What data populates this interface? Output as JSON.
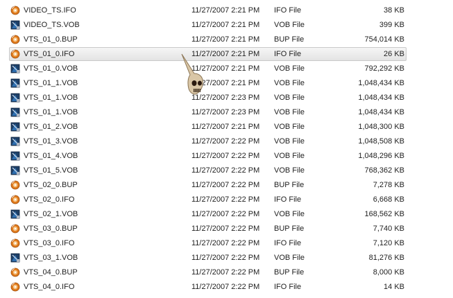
{
  "icons": {
    "IFO File": "ifo-file-icon",
    "BUP File": "bup-file-icon",
    "VOB File": "vob-file-icon"
  },
  "selected_index": 3,
  "files": [
    {
      "name": "VIDEO_TS.IFO",
      "date": "11/27/2007 2:21 PM",
      "type": "IFO File",
      "size": "38 KB"
    },
    {
      "name": "VIDEO_TS.VOB",
      "date": "11/27/2007 2:21 PM",
      "type": "VOB File",
      "size": "399 KB"
    },
    {
      "name": "VTS_01_0.BUP",
      "date": "11/27/2007 2:21 PM",
      "type": "BUP File",
      "size": "754,014 KB"
    },
    {
      "name": "VTS_01_0.IFO",
      "date": "11/27/2007 2:21 PM",
      "type": "IFO File",
      "size": "26 KB"
    },
    {
      "name": "VTS_01_0.VOB",
      "date": "11/27/2007 2:21 PM",
      "type": "VOB File",
      "size": "792,292 KB"
    },
    {
      "name": "VTS_01_1.VOB",
      "date": "11/27/2007 2:21 PM",
      "type": "VOB File",
      "size": "1,048,434 KB"
    },
    {
      "name": "VTS_01_1.VOB",
      "date": "11/27/2007 2:23 PM",
      "type": "VOB File",
      "size": "1,048,434 KB"
    },
    {
      "name": "VTS_01_1.VOB",
      "date": "11/27/2007 2:23 PM",
      "type": "VOB File",
      "size": "1,048,434 KB"
    },
    {
      "name": "VTS_01_2.VOB",
      "date": "11/27/2007 2:21 PM",
      "type": "VOB File",
      "size": "1,048,300 KB"
    },
    {
      "name": "VTS_01_3.VOB",
      "date": "11/27/2007 2:22 PM",
      "type": "VOB File",
      "size": "1,048,508 KB"
    },
    {
      "name": "VTS_01_4.VOB",
      "date": "11/27/2007 2:22 PM",
      "type": "VOB File",
      "size": "1,048,296 KB"
    },
    {
      "name": "VTS_01_5.VOB",
      "date": "11/27/2007 2:22 PM",
      "type": "VOB File",
      "size": "768,362 KB"
    },
    {
      "name": "VTS_02_0.BUP",
      "date": "11/27/2007 2:22 PM",
      "type": "BUP File",
      "size": "7,278 KB"
    },
    {
      "name": "VTS_02_0.IFO",
      "date": "11/27/2007 2:22 PM",
      "type": "IFO File",
      "size": "6,668 KB"
    },
    {
      "name": "VTS_02_1.VOB",
      "date": "11/27/2007 2:22 PM",
      "type": "VOB File",
      "size": "168,562 KB"
    },
    {
      "name": "VTS_03_0.BUP",
      "date": "11/27/2007 2:22 PM",
      "type": "BUP File",
      "size": "7,740 KB"
    },
    {
      "name": "VTS_03_0.IFO",
      "date": "11/27/2007 2:22 PM",
      "type": "IFO File",
      "size": "7,120 KB"
    },
    {
      "name": "VTS_03_1.VOB",
      "date": "11/27/2007 2:22 PM",
      "type": "VOB File",
      "size": "81,276 KB"
    },
    {
      "name": "VTS_04_0.BUP",
      "date": "11/27/2007 2:22 PM",
      "type": "BUP File",
      "size": "8,000 KB"
    },
    {
      "name": "VTS_04_0.IFO",
      "date": "11/27/2007 2:22 PM",
      "type": "IFO File",
      "size": "14 KB"
    }
  ]
}
